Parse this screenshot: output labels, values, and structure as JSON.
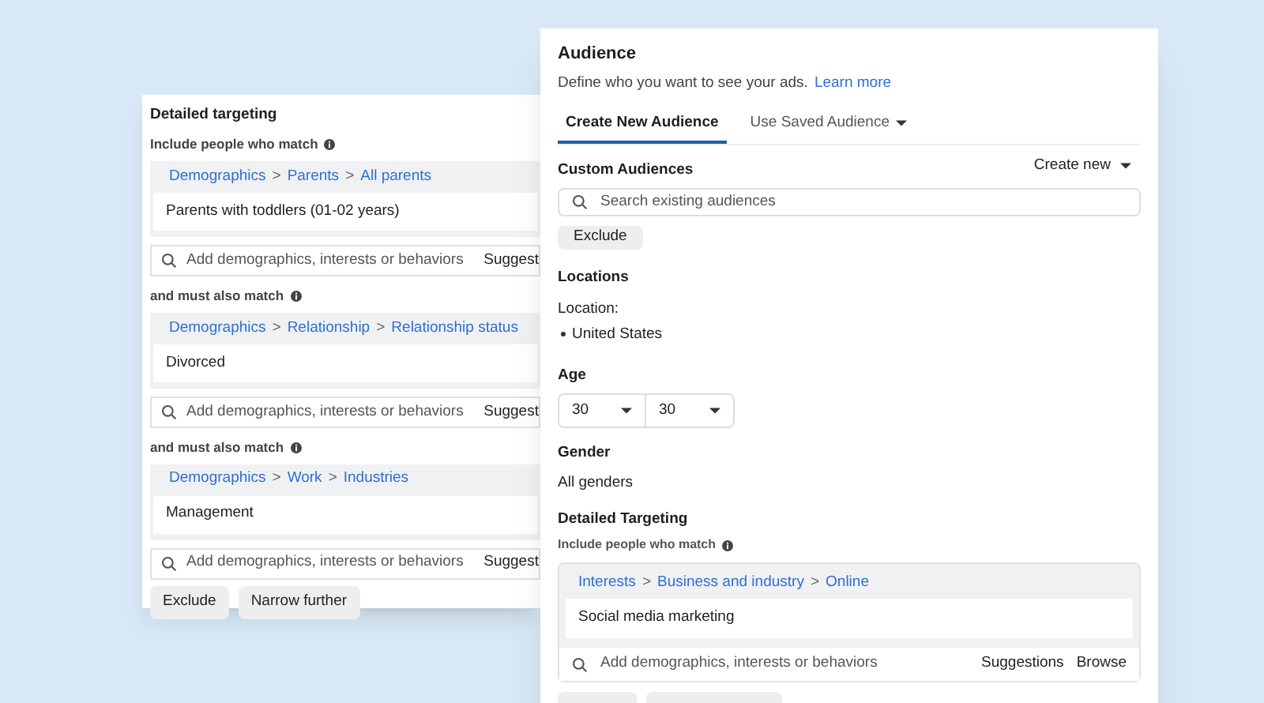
{
  "back_panel": {
    "title": "Detailed targeting",
    "include_label": "Include people who match",
    "groups": [
      {
        "path": [
          "Demographics",
          "Parents",
          "All parents"
        ],
        "separator": ">",
        "value": "Parents with toddlers (01-02 years)",
        "search_placeholder": "Add demographics, interests or behaviors",
        "suggest": "Suggest"
      },
      {
        "heading": "and must also match",
        "path": [
          "Demographics",
          "Relationship",
          "Relationship status"
        ],
        "separator": ">",
        "value": "Divorced",
        "search_placeholder": "Add demographics, interests or behaviors",
        "suggest": "Suggest"
      },
      {
        "heading": "and must also match",
        "path": [
          "Demographics",
          "Work",
          "Industries"
        ],
        "separator": ">",
        "value": "Management",
        "search_placeholder": "Add demographics, interests or behaviors",
        "suggest": "Suggest"
      }
    ],
    "buttons": [
      "Exclude",
      "Narrow further"
    ]
  },
  "audience_panel": {
    "title": "Audience",
    "subtitle": "Define who you want to see your ads.",
    "learn_more": "Learn more",
    "tabs": [
      {
        "label": "Create New Audience",
        "selected": true,
        "dropdown": false
      },
      {
        "label": "Use Saved Audience",
        "selected": false,
        "dropdown": true
      }
    ],
    "custom_audiences": {
      "label": "Custom Audiences",
      "create_new": "Create new",
      "search_placeholder": "Search existing audiences",
      "exclude": "Exclude"
    },
    "locations": {
      "label": "Locations",
      "sub_label": "Location:",
      "items": [
        "United States"
      ]
    },
    "age": {
      "label": "Age",
      "min": "30",
      "max": "30"
    },
    "gender": {
      "label": "Gender",
      "value": "All genders"
    },
    "detailed_targeting": {
      "label": "Detailed Targeting",
      "include_label": "Include people who match",
      "path": [
        "Interests",
        "Business and industry",
        "Online"
      ],
      "separator": ">",
      "value": "Social media marketing",
      "search_placeholder": "Add demographics, interests or behaviors",
      "suggestions": "Suggestions",
      "browse": "Browse"
    }
  }
}
